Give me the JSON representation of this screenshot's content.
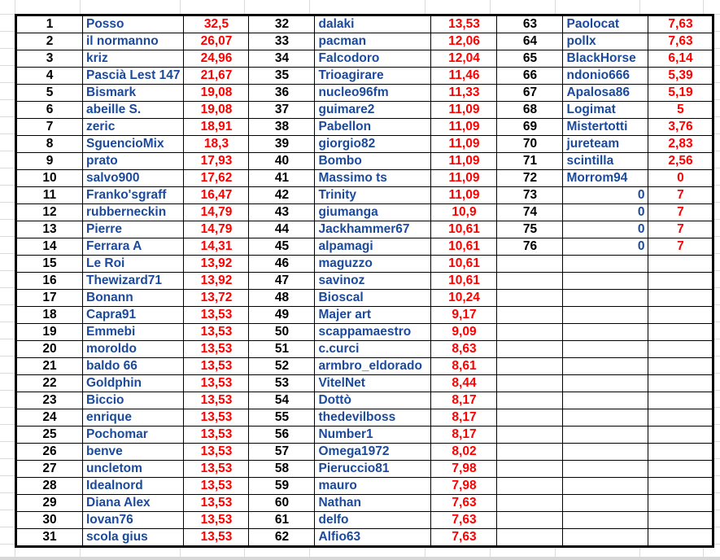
{
  "colors": {
    "name": "#1b4a9c",
    "score": "#ff0000",
    "rank": "#000000"
  },
  "ranking": [
    [
      "1",
      "Posso",
      "32,5"
    ],
    [
      "2",
      "il normanno",
      "26,07"
    ],
    [
      "3",
      "kriz",
      "24,96"
    ],
    [
      "4",
      "Pascià Lest 147",
      "21,67"
    ],
    [
      "5",
      "Bismark",
      "19,08"
    ],
    [
      "6",
      "abeille S.",
      "19,08"
    ],
    [
      "7",
      "zeric",
      "18,91"
    ],
    [
      "8",
      "SguencioMix",
      "18,3"
    ],
    [
      "9",
      "prato",
      "17,93"
    ],
    [
      "10",
      "salvo900",
      "17,62"
    ],
    [
      "11",
      "Franko'sgraff",
      "16,47"
    ],
    [
      "12",
      "rubberneckin",
      "14,79"
    ],
    [
      "13",
      "Pierre",
      "14,79"
    ],
    [
      "14",
      "Ferrara A",
      "14,31"
    ],
    [
      "15",
      "Le Roi",
      "13,92"
    ],
    [
      "16",
      "Thewizard71",
      "13,92"
    ],
    [
      "17",
      "Bonann",
      "13,72"
    ],
    [
      "18",
      "Capra91",
      "13,53"
    ],
    [
      "19",
      "Emmebi",
      "13,53"
    ],
    [
      "20",
      "moroldo",
      "13,53"
    ],
    [
      "21",
      "baldo 66",
      "13,53"
    ],
    [
      "22",
      "Goldphin",
      "13,53"
    ],
    [
      "23",
      "Biccio",
      "13,53"
    ],
    [
      "24",
      "enrique",
      "13,53"
    ],
    [
      "25",
      "Pochomar",
      "13,53"
    ],
    [
      "26",
      "benve",
      "13,53"
    ],
    [
      "27",
      "uncletom",
      "13,53"
    ],
    [
      "28",
      "Idealnord",
      "13,53"
    ],
    [
      "29",
      "Diana Alex",
      "13,53"
    ],
    [
      "30",
      "lovan76",
      "13,53"
    ],
    [
      "31",
      "scola gius",
      "13,53"
    ],
    [
      "32",
      "dalaki",
      "13,53"
    ],
    [
      "33",
      "pacman",
      "12,06"
    ],
    [
      "34",
      "Falcodoro",
      "12,04"
    ],
    [
      "35",
      "Trioagirare",
      "11,46"
    ],
    [
      "36",
      "nucleo96fm",
      "11,33"
    ],
    [
      "37",
      "guimare2",
      "11,09"
    ],
    [
      "38",
      "Pabellon",
      "11,09"
    ],
    [
      "39",
      "giorgio82",
      "11,09"
    ],
    [
      "40",
      "Bombo",
      "11,09"
    ],
    [
      "41",
      "Massimo ts",
      "11,09"
    ],
    [
      "42",
      "Trinity",
      "11,09"
    ],
    [
      "43",
      "giumanga",
      "10,9"
    ],
    [
      "44",
      "Jackhammer67",
      "10,61"
    ],
    [
      "45",
      "alpamagi",
      "10,61"
    ],
    [
      "46",
      "maguzzo",
      "10,61"
    ],
    [
      "47",
      "savinoz",
      "10,61"
    ],
    [
      "48",
      "Bioscal",
      "10,24"
    ],
    [
      "49",
      "Majer art",
      "9,17"
    ],
    [
      "50",
      "scappamaestro",
      "9,09"
    ],
    [
      "51",
      "c.curci",
      "8,63"
    ],
    [
      "52",
      "armbro_eldorado",
      "8,61"
    ],
    [
      "53",
      "VitelNet",
      "8,44"
    ],
    [
      "54",
      "Dottò",
      "8,17"
    ],
    [
      "55",
      "thedevilboss",
      "8,17"
    ],
    [
      "56",
      "Number1",
      "8,17"
    ],
    [
      "57",
      "Omega1972",
      "8,02"
    ],
    [
      "58",
      "Pieruccio81",
      "7,98"
    ],
    [
      "59",
      "mauro",
      "7,98"
    ],
    [
      "60",
      "Nathan",
      "7,63"
    ],
    [
      "61",
      "delfo",
      "7,63"
    ],
    [
      "62",
      "Alfio63",
      "7,63"
    ],
    [
      "63",
      "Paolocat",
      "7,63"
    ],
    [
      "64",
      "pollx",
      "7,63"
    ],
    [
      "65",
      "BlackHorse",
      "6,14"
    ],
    [
      "66",
      "ndonio666",
      "5,39"
    ],
    [
      "67",
      "Apalosa86",
      "5,19"
    ],
    [
      "68",
      "Logimat",
      "5"
    ],
    [
      "69",
      "Mistertotti",
      "3,76"
    ],
    [
      "70",
      "jureteam",
      "2,83"
    ],
    [
      "71",
      "scintilla",
      "2,56"
    ],
    [
      "72",
      "Morrom94",
      "0"
    ],
    [
      "73",
      "0",
      "7"
    ],
    [
      "74",
      "0",
      "7"
    ],
    [
      "75",
      "0",
      "7"
    ],
    [
      "76",
      "0",
      "7"
    ]
  ]
}
